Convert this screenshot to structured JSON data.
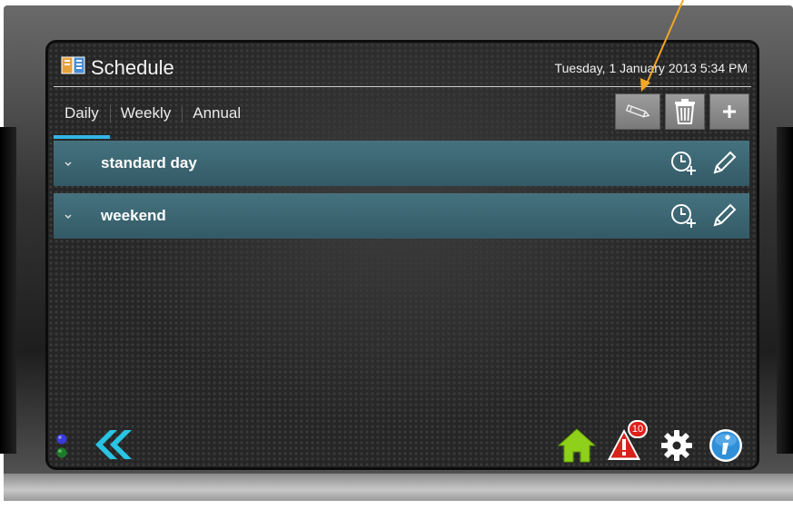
{
  "window": {
    "title": "Schedule",
    "datetime": "Tuesday, 1 January 2013 5:34 PM"
  },
  "tabs": [
    {
      "label": "Daily",
      "active": true
    },
    {
      "label": "Weekly",
      "active": false
    },
    {
      "label": "Annual",
      "active": false
    }
  ],
  "toolbar": {
    "buttons": [
      {
        "icon": "pencil-icon"
      },
      {
        "icon": "trash-icon"
      },
      {
        "icon": "plus-icon"
      }
    ]
  },
  "schedules": [
    {
      "name": "standard day"
    },
    {
      "name": "weekend"
    }
  ],
  "footer": {
    "alarm_count": "10",
    "icons": [
      "status-led-icon",
      "double-chevron-left-icon",
      "home-icon",
      "alarm-icon",
      "gear-icon",
      "info-icon"
    ]
  },
  "colors": {
    "accent": "#33b5e5",
    "row_bg": "#3d6875",
    "home": "#8fd11a",
    "alarm": "#e0201b",
    "back": "#29c3e3",
    "info": "#2f8fd8",
    "annotation_arrow": "#f5a623"
  }
}
